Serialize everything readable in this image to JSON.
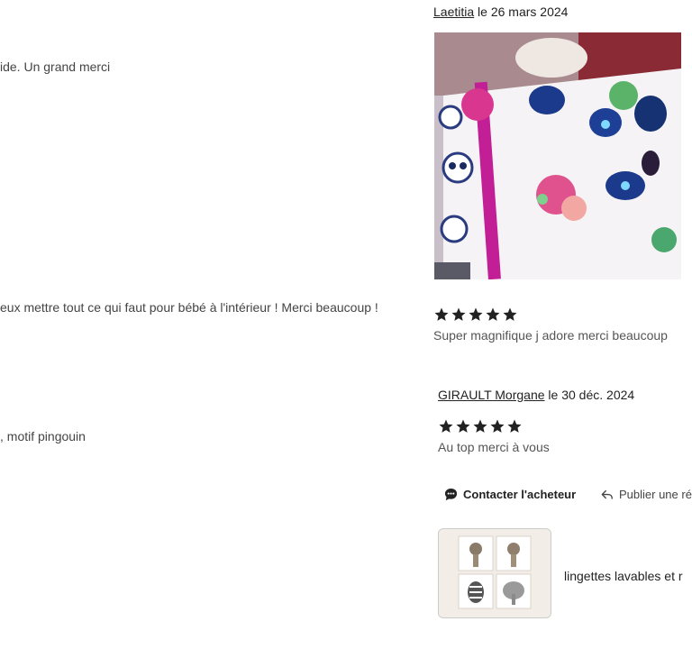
{
  "left_column": {
    "snippets": [
      "ide. Un grand merci",
      "eux mettre tout ce qui faut pour bébé à l'intérieur ! Merci beaucoup !",
      ", motif pingouin"
    ]
  },
  "reviews": [
    {
      "author": "Laetitia",
      "date_prefix": " le ",
      "date": "26 mars 2024",
      "rating": 5,
      "text": "Super magnifique j adore merci beaucoup",
      "photo_icon": "panda-blanket-photo"
    },
    {
      "author": "GIRAULT Morgane",
      "date_prefix": " le ",
      "date": "30 déc. 2024",
      "rating": 5,
      "text": "Au top merci à vous"
    }
  ],
  "actions": {
    "contact_label": "Contacter l'acheteur",
    "contact_icon": "chat-bubble-icon",
    "reply_label": "Publier une ré",
    "reply_icon": "reply-arrow-icon"
  },
  "product": {
    "title": "lingettes lavables et r",
    "thumbnail_icon": "animal-wipes-thumbnail"
  },
  "colors": {
    "star": "#222222",
    "text": "#222222",
    "muted": "#555555"
  }
}
